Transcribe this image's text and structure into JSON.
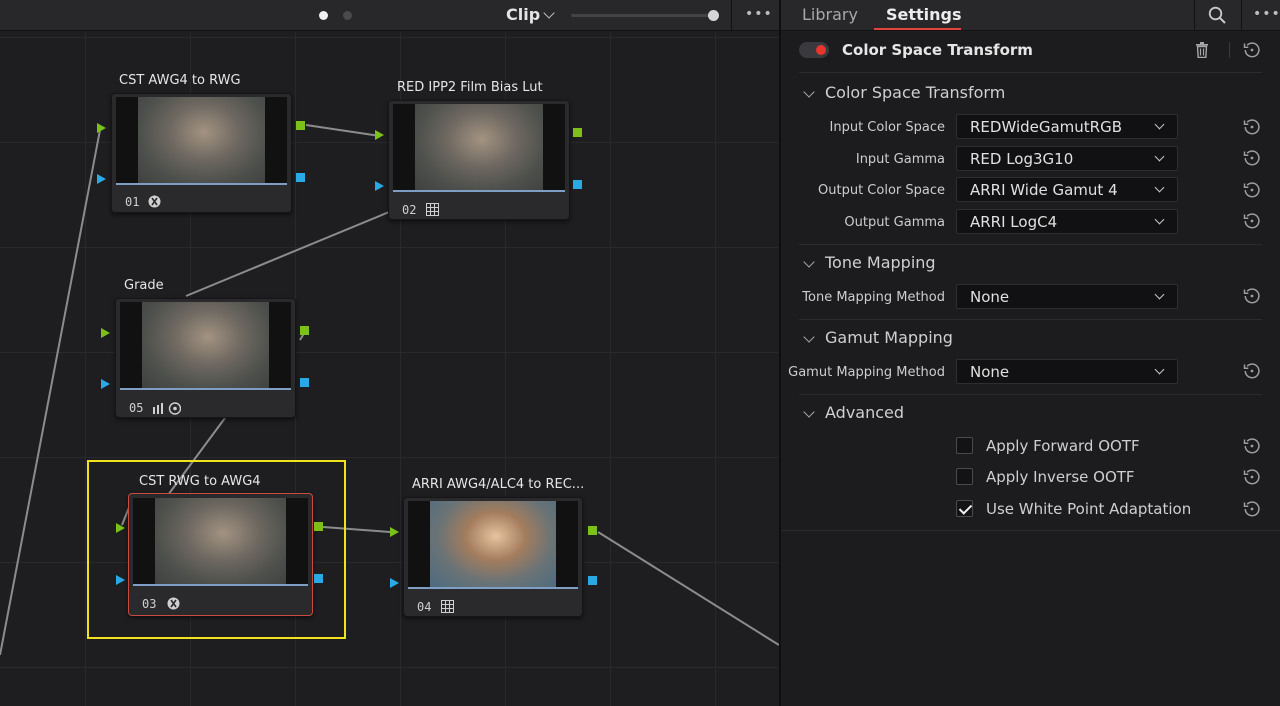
{
  "toolbar": {
    "clip_label": "Clip",
    "more_label": "•••"
  },
  "tabs": [
    {
      "label": "Library",
      "active": false
    },
    {
      "label": "Settings",
      "active": true
    }
  ],
  "nodes": [
    {
      "title": "CST AWG4 to RWG",
      "number": "01",
      "icon": "transform-icon"
    },
    {
      "title": "RED IPP2 Film Bias Lut",
      "number": "02",
      "icon": "lut-icon"
    },
    {
      "title": "Grade",
      "number": "05",
      "icon": "bars-icon"
    },
    {
      "title": "CST RWG  to AWG4",
      "number": "03",
      "icon": "transform-icon"
    },
    {
      "title": "ARRI AWG4/ALC4 to REC...",
      "number": "04",
      "icon": "lut-icon"
    }
  ],
  "panel": {
    "effect_title": "Color Space Transform",
    "sections": {
      "cst": "Color Space Transform",
      "tone": "Tone Mapping",
      "gamut": "Gamut Mapping",
      "advanced": "Advanced"
    },
    "fields": [
      {
        "label": "Input Color Space",
        "value": "REDWideGamutRGB"
      },
      {
        "label": "Input Gamma",
        "value": "RED Log3G10"
      },
      {
        "label": "Output Color Space",
        "value": "ARRI Wide Gamut 4"
      },
      {
        "label": "Output Gamma",
        "value": "ARRI LogC4"
      }
    ],
    "tone_mapping": {
      "label": "Tone Mapping Method",
      "value": "None"
    },
    "gamut_mapping": {
      "label": "Gamut Mapping Method",
      "value": "None"
    },
    "checks": [
      {
        "label": "Apply Forward OOTF",
        "checked": false
      },
      {
        "label": "Apply Inverse OOTF",
        "checked": false
      },
      {
        "label": "Use White Point Adaptation",
        "checked": true
      }
    ]
  },
  "colors": {
    "accent": "#e0463b",
    "selection": "#f1e31b",
    "port_green": "#7cc11a",
    "port_blue": "#29a9e6"
  }
}
